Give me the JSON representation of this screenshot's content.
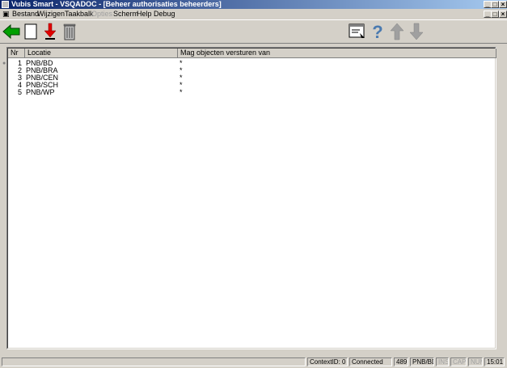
{
  "window": {
    "title": "Vubis Smart - VSQADOC - [Beheer authorisaties beheerders]"
  },
  "menu": {
    "items": [
      "Bestand",
      "Wijzigen",
      "Taakbalk",
      "Opties",
      "Scherm",
      "Help",
      "Debug"
    ],
    "disabled": [
      "Opties"
    ]
  },
  "toolbar": {
    "buttons": [
      "back-arrow-icon",
      "new-document-icon",
      "download-arrow-icon",
      "trash-icon",
      "window-select-icon",
      "help-question-icon",
      "arrow-up-icon",
      "arrow-down-icon"
    ]
  },
  "grid": {
    "columns": [
      "Nr",
      "Locatie",
      "Mag objecten versturen van"
    ],
    "rows": [
      {
        "nr": "1",
        "locatie": "PNB/BD",
        "mag": "*"
      },
      {
        "nr": "2",
        "locatie": "PNB/BRA",
        "mag": "*"
      },
      {
        "nr": "3",
        "locatie": "PNB/CEN",
        "mag": "*"
      },
      {
        "nr": "4",
        "locatie": "PNB/SCH",
        "mag": "*"
      },
      {
        "nr": "5",
        "locatie": "PNB/WP",
        "mag": "*"
      }
    ]
  },
  "status": {
    "context": "ContextID: 0",
    "connection": "Connected",
    "count": "489",
    "location": "PNB/BD",
    "ins": "INS",
    "caps": "CAPS",
    "num": "NUM",
    "time": "15:01"
  },
  "colors": {
    "titlebar_start": "#0a246a",
    "titlebar_end": "#a6caf0",
    "window_bg": "#d4d0c8",
    "green_arrow": "#00a000",
    "red_arrow": "#e00000"
  }
}
